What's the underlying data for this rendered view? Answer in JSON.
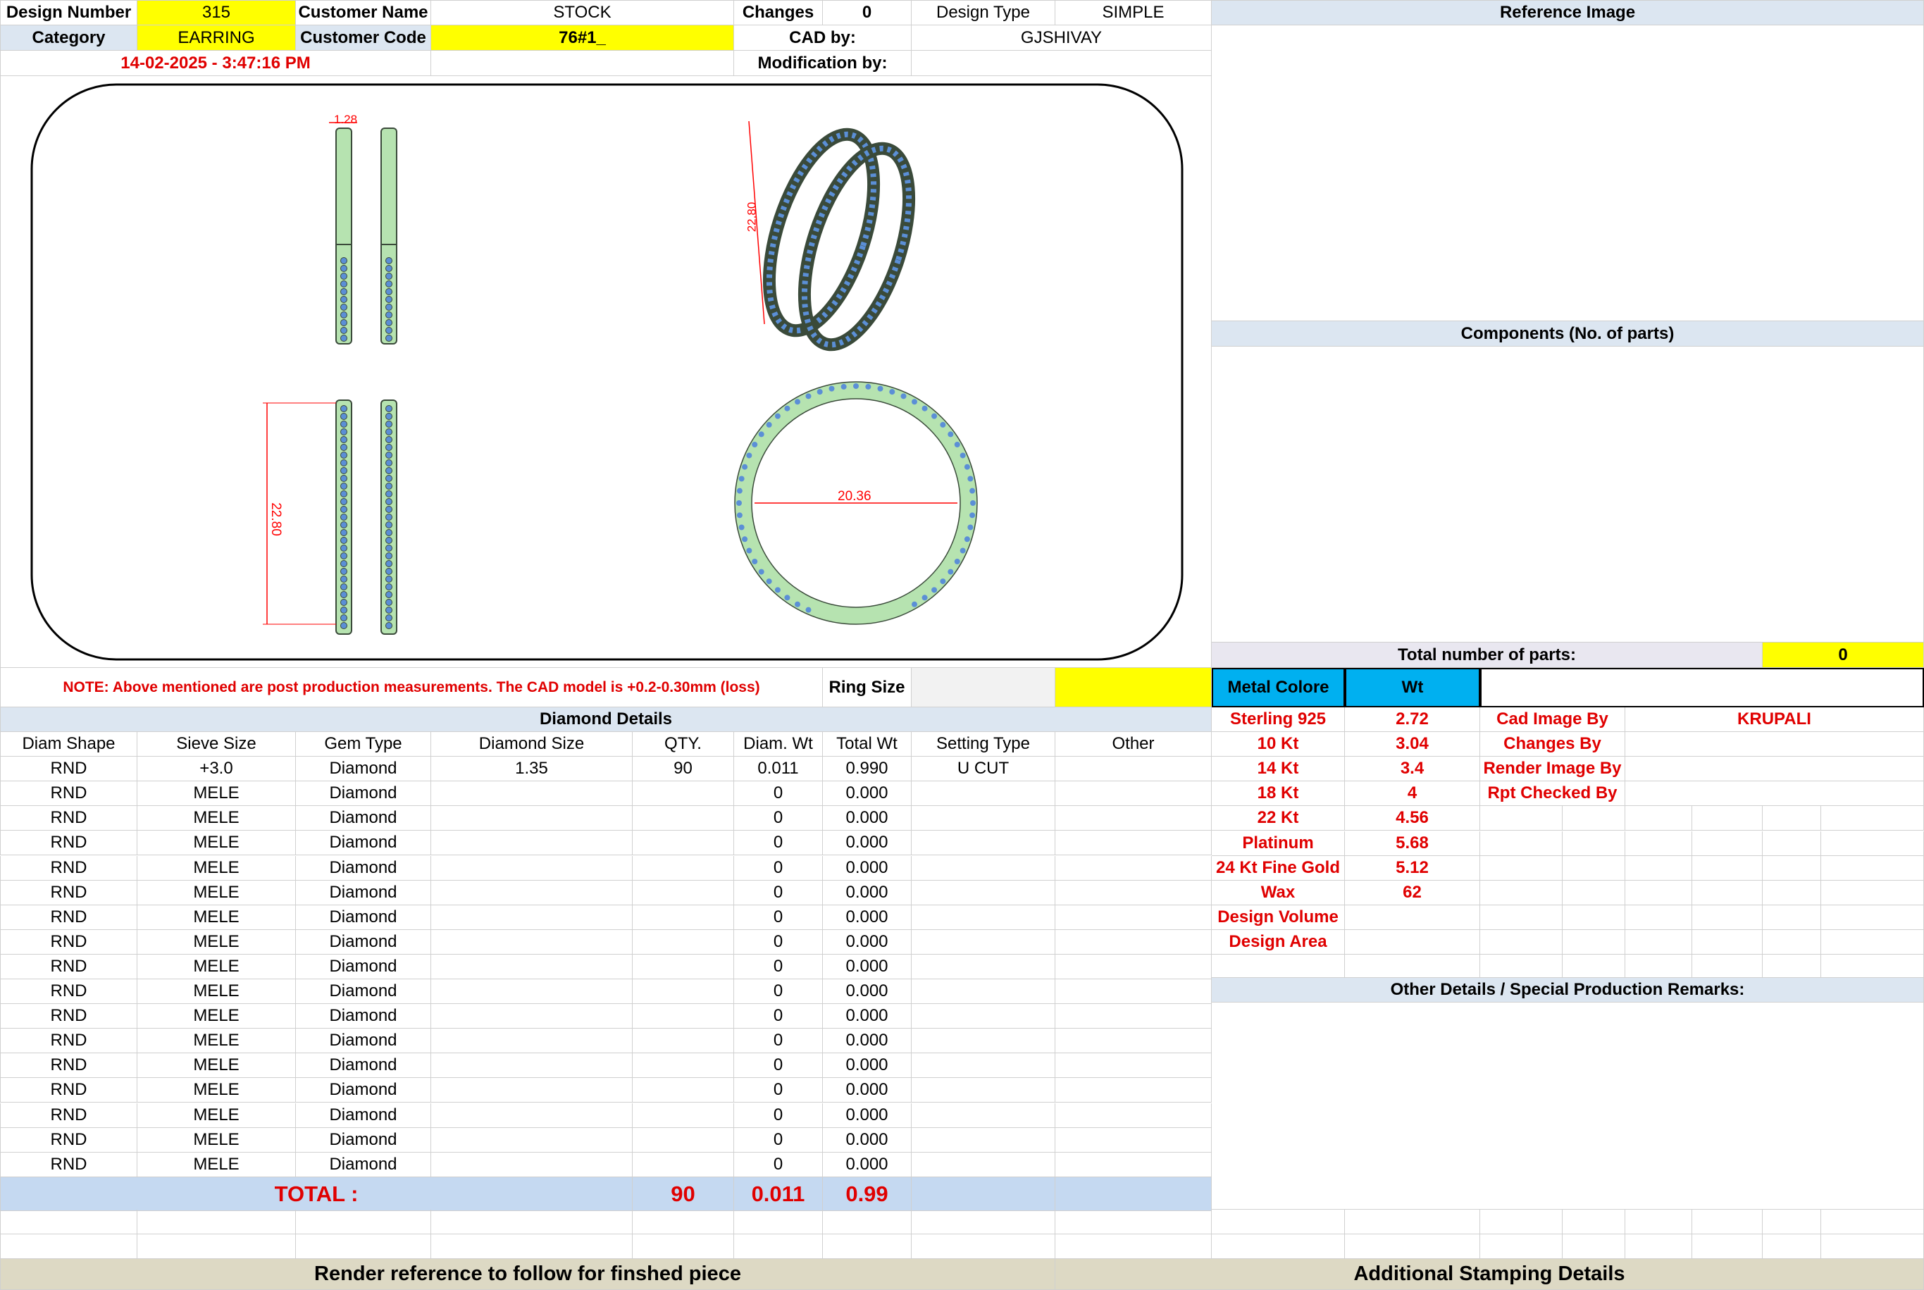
{
  "header": {
    "design_number_label": "Design Number",
    "design_number": "315",
    "customer_name_label": "Customer Name",
    "customer_name": "STOCK",
    "changes_label": "Changes",
    "changes": "0",
    "design_type_label": "Design Type",
    "design_type": "SIMPLE",
    "category_label": "Category",
    "category": "EARRING",
    "customer_code_label": "Customer Code",
    "customer_code": "76#1_",
    "cad_by_label": "CAD by:",
    "cad_by": "GJSHIVAY",
    "date": "14-02-2025 - 3:47:16 PM",
    "modification_by_label": "Modification by:"
  },
  "drawing": {
    "dim_width": "1.28",
    "dim_height_top": "22.80",
    "dim_height_side": "22.80",
    "dim_diameter": "20.36",
    "colors": {
      "metal": "#b6e3b0",
      "metal_dark": "#3a4a3a",
      "stone": "#5b8fd6",
      "dimension": "#ff0000"
    }
  },
  "reference": {
    "reference_image_label": "Reference Image",
    "components_label": "Components (No. of parts)",
    "total_parts_label": "Total number of parts:",
    "total_parts": "0"
  },
  "note": {
    "text": "NOTE: Above mentioned are post production measurements. The CAD model is +0.2-0.30mm (loss)",
    "ring_size_label": "Ring Size"
  },
  "diamond": {
    "title": "Diamond Details",
    "columns": [
      "Diam Shape",
      "Sieve Size",
      "Gem Type",
      "Diamond Size",
      "QTY.",
      "Diam. Wt",
      "Total Wt",
      "Setting Type",
      "Other"
    ],
    "rows": [
      [
        "RND",
        "+3.0",
        "Diamond",
        "1.35",
        "90",
        "0.011",
        "0.990",
        "U CUT",
        ""
      ],
      [
        "RND",
        "MELE",
        "Diamond",
        "",
        "",
        "0",
        "0.000",
        "",
        ""
      ],
      [
        "RND",
        "MELE",
        "Diamond",
        "",
        "",
        "0",
        "0.000",
        "",
        ""
      ],
      [
        "RND",
        "MELE",
        "Diamond",
        "",
        "",
        "0",
        "0.000",
        "",
        ""
      ],
      [
        "RND",
        "MELE",
        "Diamond",
        "",
        "",
        "0",
        "0.000",
        "",
        ""
      ],
      [
        "RND",
        "MELE",
        "Diamond",
        "",
        "",
        "0",
        "0.000",
        "",
        ""
      ],
      [
        "RND",
        "MELE",
        "Diamond",
        "",
        "",
        "0",
        "0.000",
        "",
        ""
      ],
      [
        "RND",
        "MELE",
        "Diamond",
        "",
        "",
        "0",
        "0.000",
        "",
        ""
      ],
      [
        "RND",
        "MELE",
        "Diamond",
        "",
        "",
        "0",
        "0.000",
        "",
        ""
      ],
      [
        "RND",
        "MELE",
        "Diamond",
        "",
        "",
        "0",
        "0.000",
        "",
        ""
      ],
      [
        "RND",
        "MELE",
        "Diamond",
        "",
        "",
        "0",
        "0.000",
        "",
        ""
      ],
      [
        "RND",
        "MELE",
        "Diamond",
        "",
        "",
        "0",
        "0.000",
        "",
        ""
      ],
      [
        "RND",
        "MELE",
        "Diamond",
        "",
        "",
        "0",
        "0.000",
        "",
        ""
      ],
      [
        "RND",
        "MELE",
        "Diamond",
        "",
        "",
        "0",
        "0.000",
        "",
        ""
      ],
      [
        "RND",
        "MELE",
        "Diamond",
        "",
        "",
        "0",
        "0.000",
        "",
        ""
      ],
      [
        "RND",
        "MELE",
        "Diamond",
        "",
        "",
        "0",
        "0.000",
        "",
        ""
      ],
      [
        "RND",
        "MELE",
        "Diamond",
        "",
        "",
        "0",
        "0.000",
        "",
        ""
      ]
    ],
    "total_label": "TOTAL :",
    "total_qty": "90",
    "total_diam_wt": "0.011",
    "total_wt": "0.99"
  },
  "metal": {
    "header_metal": "Metal Colore",
    "header_wt": "Wt",
    "rows": [
      {
        "name": "Sterling 925",
        "wt": "2.72"
      },
      {
        "name": "10 Kt",
        "wt": "3.04"
      },
      {
        "name": "14 Kt",
        "wt": "3.4"
      },
      {
        "name": "18 Kt",
        "wt": "4"
      },
      {
        "name": "22 Kt",
        "wt": "4.56"
      },
      {
        "name": "Platinum",
        "wt": "5.68"
      },
      {
        "name": "24 Kt Fine Gold",
        "wt": "5.12"
      },
      {
        "name": "Wax",
        "wt": "62"
      },
      {
        "name": "Design Volume",
        "wt": ""
      },
      {
        "name": "Design Area",
        "wt": ""
      }
    ]
  },
  "credits": [
    {
      "label": "Cad Image By",
      "value": "KRUPALI"
    },
    {
      "label": "Changes By",
      "value": ""
    },
    {
      "label": "Render Image By",
      "value": ""
    },
    {
      "label": "Rpt Checked By",
      "value": ""
    }
  ],
  "other_details_label": "Other Details / Special Production Remarks:",
  "footer": {
    "render_reference": "Render reference to follow for finshed piece",
    "stamping": "Additional Stamping Details"
  }
}
